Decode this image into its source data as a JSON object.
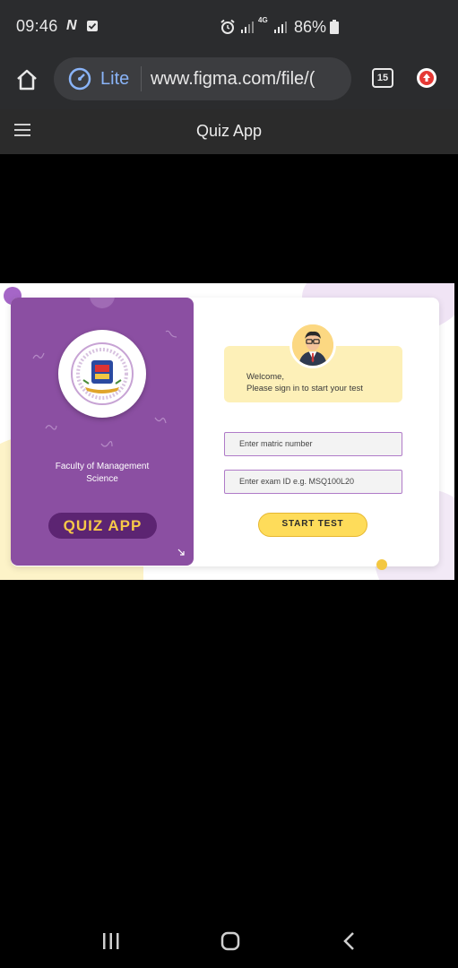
{
  "status_bar": {
    "time": "09:46",
    "network_badge": "4G",
    "battery": "86%"
  },
  "browser": {
    "lite_label": "Lite",
    "url": "www.figma.com/file/(",
    "tab_count": "15"
  },
  "app": {
    "title": "Quiz App"
  },
  "quiz_card": {
    "faculty_line1": "Faculty of Management",
    "faculty_line2": "Science",
    "app_badge": "QUIZ  APP",
    "welcome_line1": "Welcome,",
    "welcome_line2": "Please sign in to start your test",
    "matric_placeholder": "Enter matric number",
    "exam_placeholder": "Enter exam ID  e.g. MSQ100L20",
    "start_button": "START  TEST"
  },
  "colors": {
    "panel_purple": "#8b4fa2",
    "badge_dark_purple": "#5c2472",
    "accent_yellow": "#fedc5a",
    "welcome_bg": "#fdf0b8",
    "field_border": "#b07bc8"
  }
}
